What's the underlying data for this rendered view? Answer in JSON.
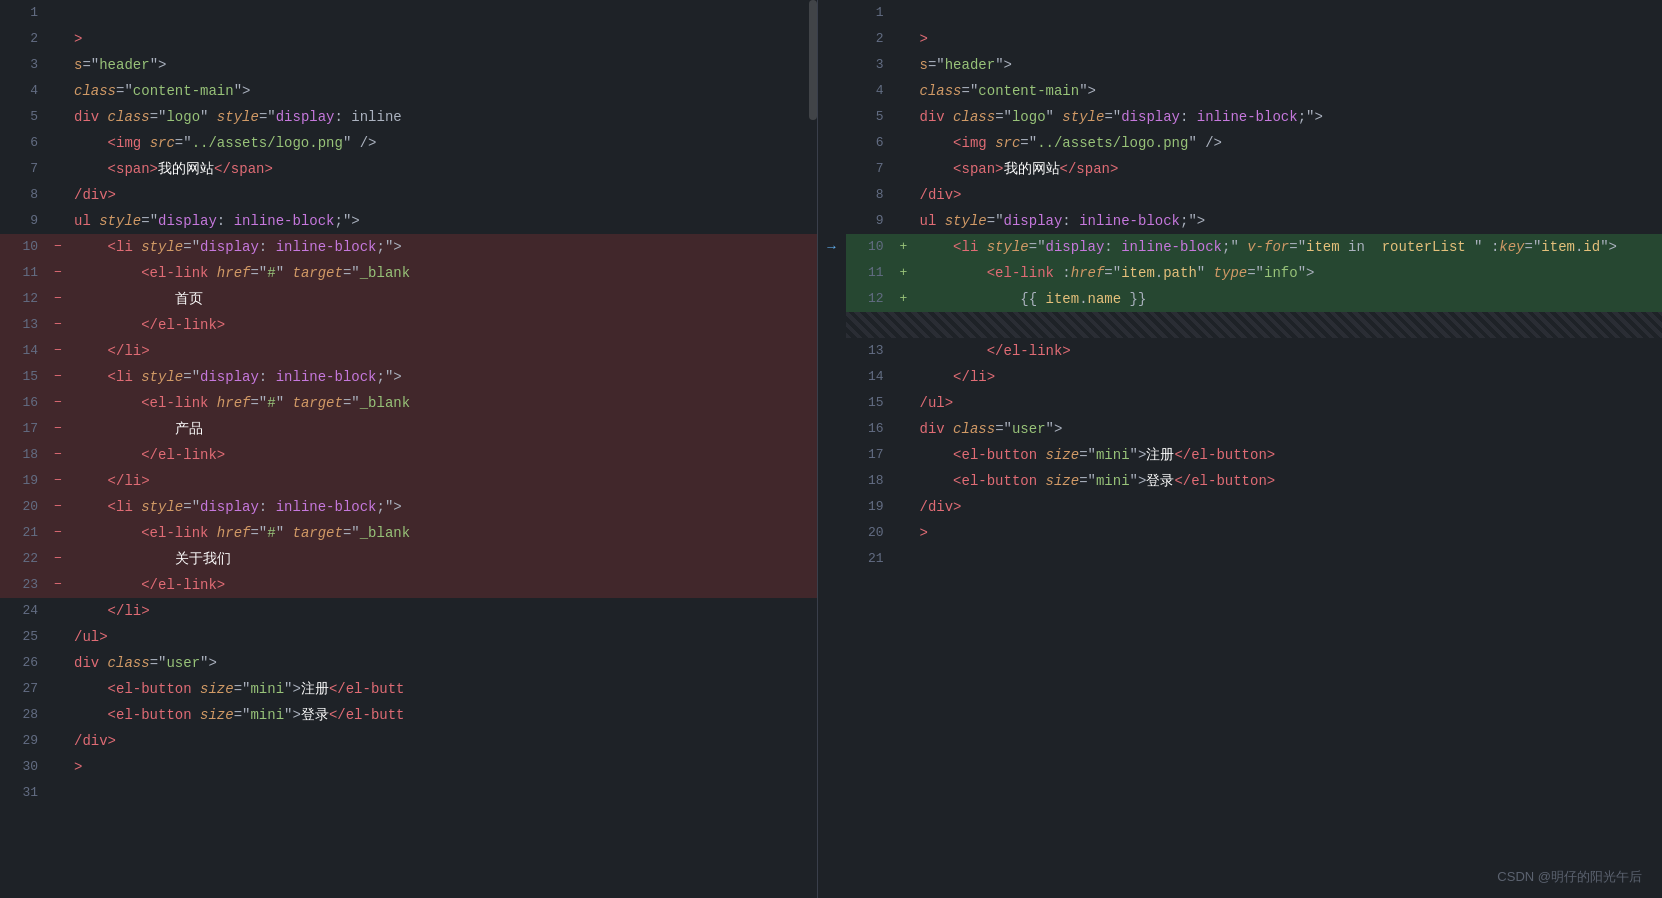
{
  "watermark": "CSDN @明仔的阳光午后",
  "left_pane": {
    "lines": [
      {
        "num": "1",
        "marker": " ",
        "type": "normal",
        "content": ""
      },
      {
        "num": "2",
        "marker": " ",
        "type": "normal",
        "content": ">"
      },
      {
        "num": "3",
        "marker": " ",
        "type": "normal",
        "content": "s=\"header\">"
      },
      {
        "num": "4",
        "marker": " ",
        "type": "normal",
        "content": "class=\"content-main\">"
      },
      {
        "num": "5",
        "marker": " ",
        "type": "normal",
        "content": "div class=\"logo\" style=\"display: inline"
      },
      {
        "num": "6",
        "marker": " ",
        "type": "normal",
        "content": "    <img src=\"../assets/logo.png\" />"
      },
      {
        "num": "7",
        "marker": " ",
        "type": "normal",
        "content": "    <span>我的网站</span>"
      },
      {
        "num": "8",
        "marker": " ",
        "type": "normal",
        "content": "/div>"
      },
      {
        "num": "9",
        "marker": " ",
        "type": "normal",
        "content": "ul style=\"display: inline-block;\">"
      },
      {
        "num": "10",
        "marker": "-",
        "type": "removed",
        "content": "    <li style=\"display: inline-block;\">"
      },
      {
        "num": "11",
        "marker": "-",
        "type": "removed",
        "content": "        <el-link href=\"#\" target=\"_blank"
      },
      {
        "num": "12",
        "marker": "-",
        "type": "removed",
        "content": "            首页"
      },
      {
        "num": "13",
        "marker": "-",
        "type": "removed",
        "content": "        </el-link>"
      },
      {
        "num": "14",
        "marker": "-",
        "type": "removed",
        "content": "    </li>"
      },
      {
        "num": "15",
        "marker": "-",
        "type": "removed",
        "content": "    <li style=\"display: inline-block;\">"
      },
      {
        "num": "16",
        "marker": "-",
        "type": "removed",
        "content": "        <el-link href=\"#\" target=\"_blank"
      },
      {
        "num": "17",
        "marker": "-",
        "type": "removed",
        "content": "            产品"
      },
      {
        "num": "18",
        "marker": "-",
        "type": "removed",
        "content": "        </el-link>"
      },
      {
        "num": "19",
        "marker": "-",
        "type": "removed",
        "content": "    </li>"
      },
      {
        "num": "20",
        "marker": "-",
        "type": "removed",
        "content": "    <li style=\"display: inline-block;\">"
      },
      {
        "num": "21",
        "marker": "-",
        "type": "removed",
        "content": "        <el-link href=\"#\" target=\"_blank"
      },
      {
        "num": "22",
        "marker": "-",
        "type": "removed",
        "content": "            关于我们"
      },
      {
        "num": "23",
        "marker": "-",
        "type": "removed",
        "content": "        </el-link>"
      },
      {
        "num": "24",
        "marker": " ",
        "type": "normal",
        "content": "    </li>"
      },
      {
        "num": "25",
        "marker": " ",
        "type": "normal",
        "content": "/ul>"
      },
      {
        "num": "26",
        "marker": " ",
        "type": "normal",
        "content": "div class=\"user\">"
      },
      {
        "num": "27",
        "marker": " ",
        "type": "normal",
        "content": "    <el-button size=\"mini\">注册</el-butt"
      },
      {
        "num": "28",
        "marker": " ",
        "type": "normal",
        "content": "    <el-button size=\"mini\">登录</el-butt"
      },
      {
        "num": "29",
        "marker": " ",
        "type": "normal",
        "content": "/div>"
      },
      {
        "num": "30",
        "marker": " ",
        "type": "normal",
        "content": ">"
      },
      {
        "num": "31",
        "marker": " ",
        "type": "normal",
        "content": ""
      }
    ]
  },
  "right_pane": {
    "lines": [
      {
        "num": "1",
        "marker": " ",
        "type": "normal",
        "content": ""
      },
      {
        "num": "2",
        "marker": " ",
        "type": "normal",
        "content": ">"
      },
      {
        "num": "3",
        "marker": " ",
        "type": "normal",
        "content": "s=\"header\">"
      },
      {
        "num": "4",
        "marker": " ",
        "type": "normal",
        "content": "class=\"content-main\">"
      },
      {
        "num": "5",
        "marker": " ",
        "type": "normal",
        "content": "div class=\"logo\" style=\"display: inline-block;\">"
      },
      {
        "num": "6",
        "marker": " ",
        "type": "normal",
        "content": "    <img src=\"../assets/logo.png\" />"
      },
      {
        "num": "7",
        "marker": " ",
        "type": "normal",
        "content": "    <span>我的网站</span>"
      },
      {
        "num": "8",
        "marker": " ",
        "type": "normal",
        "content": "/div>"
      },
      {
        "num": "9",
        "marker": " ",
        "type": "normal",
        "content": "ul style=\"display: inline-block;\">"
      },
      {
        "num": "10",
        "marker": "+",
        "type": "added",
        "content": "    <li style=\"display: inline-block;\" v-for=\"item in  routerList \" :key=\"item.id\">"
      },
      {
        "num": "11",
        "marker": "+",
        "type": "added",
        "content": "        <el-link :href=\"item.path\" type=\"info\">"
      },
      {
        "num": "12",
        "marker": "+",
        "type": "added",
        "content": "            {{ item.name }}"
      },
      {
        "num": "",
        "marker": " ",
        "type": "empty",
        "content": ""
      },
      {
        "num": "13",
        "marker": " ",
        "type": "normal",
        "content": "        </el-link>"
      },
      {
        "num": "14",
        "marker": " ",
        "type": "normal",
        "content": "    </li>"
      },
      {
        "num": "15",
        "marker": " ",
        "type": "normal",
        "content": "/ul>"
      },
      {
        "num": "16",
        "marker": " ",
        "type": "normal",
        "content": "div class=\"user\">"
      },
      {
        "num": "17",
        "marker": " ",
        "type": "normal",
        "content": "    <el-button size=\"mini\">注册</el-button>"
      },
      {
        "num": "18",
        "marker": " ",
        "type": "normal",
        "content": "    <el-button size=\"mini\">登录</el-button>"
      },
      {
        "num": "19",
        "marker": " ",
        "type": "normal",
        "content": "/div>"
      },
      {
        "num": "20",
        "marker": " ",
        "type": "normal",
        "content": ">"
      },
      {
        "num": "21",
        "marker": " ",
        "type": "normal",
        "content": ""
      }
    ]
  }
}
